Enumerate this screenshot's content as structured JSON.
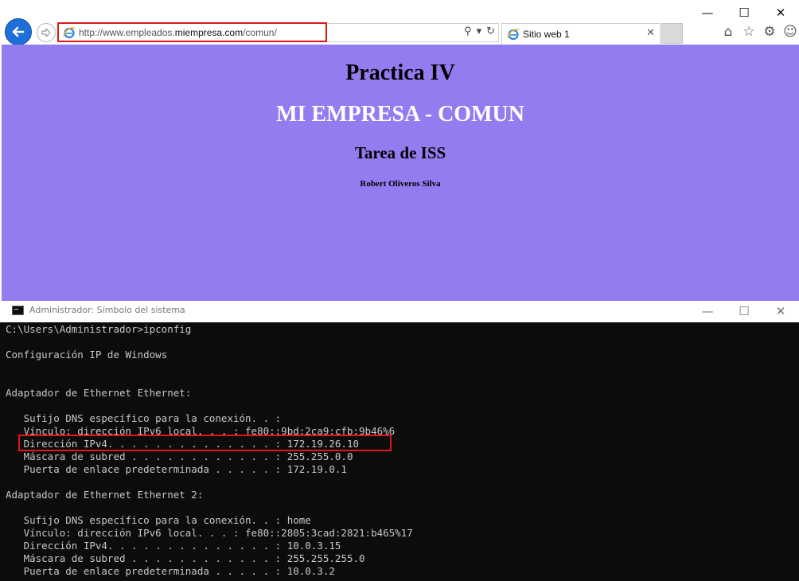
{
  "browser": {
    "window_controls": {
      "minimize": "—",
      "maximize": "☐",
      "close": "✕"
    },
    "back_glyph": "←",
    "forward_glyph": "⇨",
    "address": {
      "prefix": "http://www.empleados.",
      "domain": "miempresa.com",
      "suffix": "/comun/",
      "search_icon": "⚲",
      "dropdown_icon": "▾",
      "refresh_icon": "↻"
    },
    "tab": {
      "title": "Sitio web 1",
      "close": "✕"
    },
    "toolbar_icons": {
      "home": "⌂",
      "favorites": "☆",
      "settings": "⚙",
      "feedback": "☺"
    },
    "accent_color": "#1e6fd9",
    "page": {
      "background": "#937bf0",
      "heading1": "Practica IV",
      "heading2": "MI EMPRESA - COMUN",
      "heading3": "Tarea de ISS",
      "author": "Robert Oliveros Silva"
    }
  },
  "cmd": {
    "title": "Administrador: Símbolo del sistema",
    "window_controls": {
      "minimize": "—",
      "maximize": "☐",
      "close": "✕"
    },
    "lines": [
      "C:\\Users\\Administrador>ipconfig",
      "",
      "Configuración IP de Windows",
      "",
      "",
      "Adaptador de Ethernet Ethernet:",
      "",
      "   Sufijo DNS específico para la conexión. . :",
      "   Vínculo: dirección IPv6 local. . . : fe80::9bd:2ca9:cfb:9b46%6",
      "   Dirección IPv4. . . . . . . . . . . . . . : 172.19.26.10",
      "   Máscara de subred . . . . . . . . . . . . : 255.255.0.0",
      "   Puerta de enlace predeterminada . . . . . : 172.19.0.1",
      "",
      "Adaptador de Ethernet Ethernet 2:",
      "",
      "   Sufijo DNS específico para la conexión. . : home",
      "   Vínculo: dirección IPv6 local. . . : fe80::2805:3cad:2821:b465%17",
      "   Dirección IPv4. . . . . . . . . . . . . . : 10.0.3.15",
      "   Máscara de subred . . . . . . . . . . . . : 255.255.255.0",
      "   Puerta de enlace predeterminada . . . . . : 10.0.3.2"
    ]
  }
}
